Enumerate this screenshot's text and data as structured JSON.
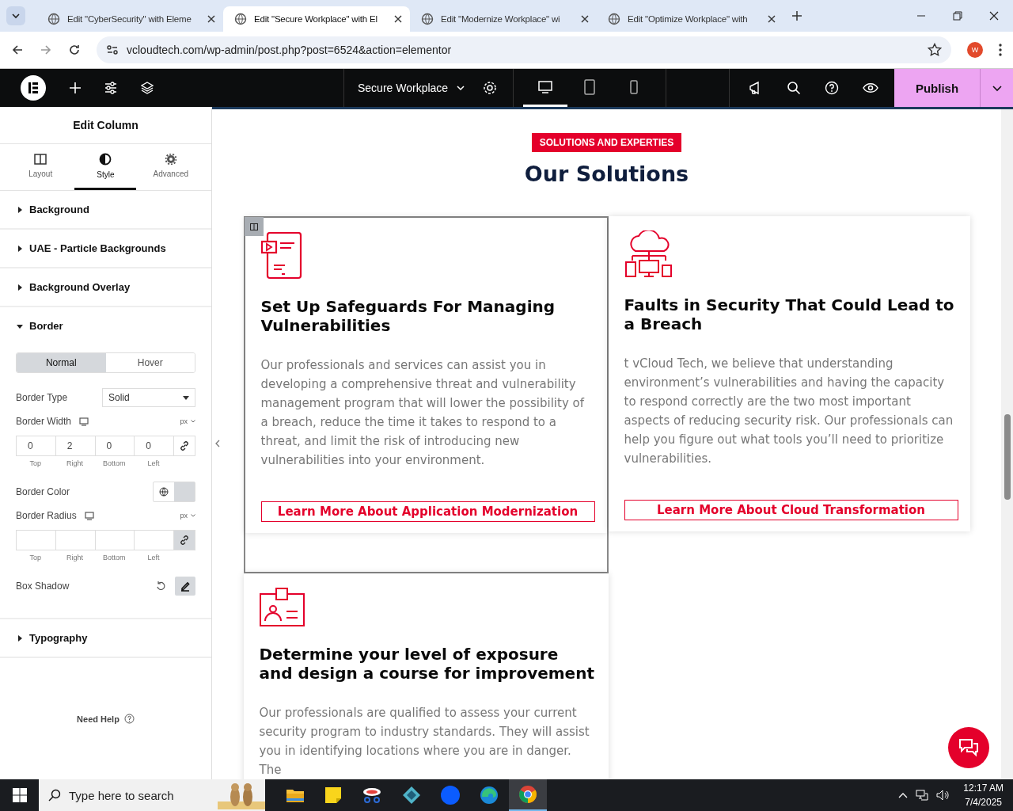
{
  "browser": {
    "tabs": [
      {
        "title": "Edit \"CyberSecurity\" with Eleme",
        "selected": false
      },
      {
        "title": "Edit \"Secure Workplace\" with El",
        "selected": true
      },
      {
        "title": "Edit \"Modernize Workplace\" wi",
        "selected": false
      },
      {
        "title": "Edit \"Optimize Workplace\" with",
        "selected": false
      }
    ],
    "url": "vcloudtech.com/wp-admin/post.php?post=6524&action=elementor",
    "profile": "W"
  },
  "editor_bar": {
    "page_title": "Secure Workplace",
    "devices": [
      {
        "kind": "desktop",
        "selected": true
      },
      {
        "kind": "tablet",
        "selected": false
      },
      {
        "kind": "mobile",
        "selected": false
      }
    ],
    "publish": "Publish"
  },
  "panel": {
    "title": "Edit Column",
    "tabs": [
      {
        "kind": "layout",
        "label": "Layout",
        "selected": false
      },
      {
        "kind": "style",
        "label": "Style",
        "selected": true
      },
      {
        "kind": "advanced",
        "label": "Advanced",
        "selected": false
      }
    ],
    "sections": [
      {
        "label": "Background",
        "expanded": false
      },
      {
        "label": "UAE - Particle Backgrounds",
        "expanded": false
      },
      {
        "label": "Background Overlay",
        "expanded": false
      },
      {
        "label": "Border",
        "expanded": true
      },
      {
        "label": "Typography",
        "expanded": false
      }
    ],
    "border": {
      "states": [
        {
          "label": "Normal",
          "selected": true
        },
        {
          "label": "Hover",
          "selected": false
        }
      ],
      "type_label": "Border Type",
      "type_value": "Solid",
      "width_label": "Border Width",
      "width_unit": "px",
      "width_fields": [
        {
          "value": "0",
          "label": "Top"
        },
        {
          "value": "2",
          "label": "Right"
        },
        {
          "value": "0",
          "label": "Bottom"
        },
        {
          "value": "0",
          "label": "Left"
        }
      ],
      "color_label": "Border Color",
      "radius_label": "Border Radius",
      "radius_unit": "px",
      "radius_fields": [
        {
          "label": "Top"
        },
        {
          "label": "Right"
        },
        {
          "label": "Bottom"
        },
        {
          "label": "Left"
        }
      ],
      "shadow_label": "Box Shadow"
    },
    "help": "Need Help"
  },
  "canvas": {
    "badge": "SOLUTIONS AND EXPERTIES",
    "heading": "Our Solutions",
    "cards": [
      {
        "kind": "tablet",
        "selected": true,
        "title": "Set Up Safeguards For Managing Vulnerabilities",
        "text": "Our professionals and services can assist you in developing a comprehensive threat and vulnerability management program that will lower the possibility of a breach, reduce the time it takes to respond to a threat, and limit the risk of introducing new vulnerabilities into your environment.",
        "link": "Learn More About Application Modernization"
      },
      {
        "kind": "cloud",
        "selected": false,
        "title": "Faults in Security That Could Lead to a Breach",
        "text": "t vCloud Tech, we believe that understanding environment’s vulnerabilities and having the capacity to respond correctly are the two most important aspects of reducing security risk. Our professionals can help you figure out what tools you’ll need to prioritize vulnerabilities.",
        "link": "Learn More About Cloud Transformation"
      },
      {
        "kind": "badge",
        "selected": false,
        "title": "Determine your level of exposure and design a course for improvement",
        "text": "Our professionals are qualified to assess your current security program to industry standards. They will assist you in identifying locations where you are in danger. The"
      }
    ]
  },
  "taskbar": {
    "search_placeholder": "Type here to search",
    "time": "12:17 AM",
    "date": "7/4/2025"
  }
}
